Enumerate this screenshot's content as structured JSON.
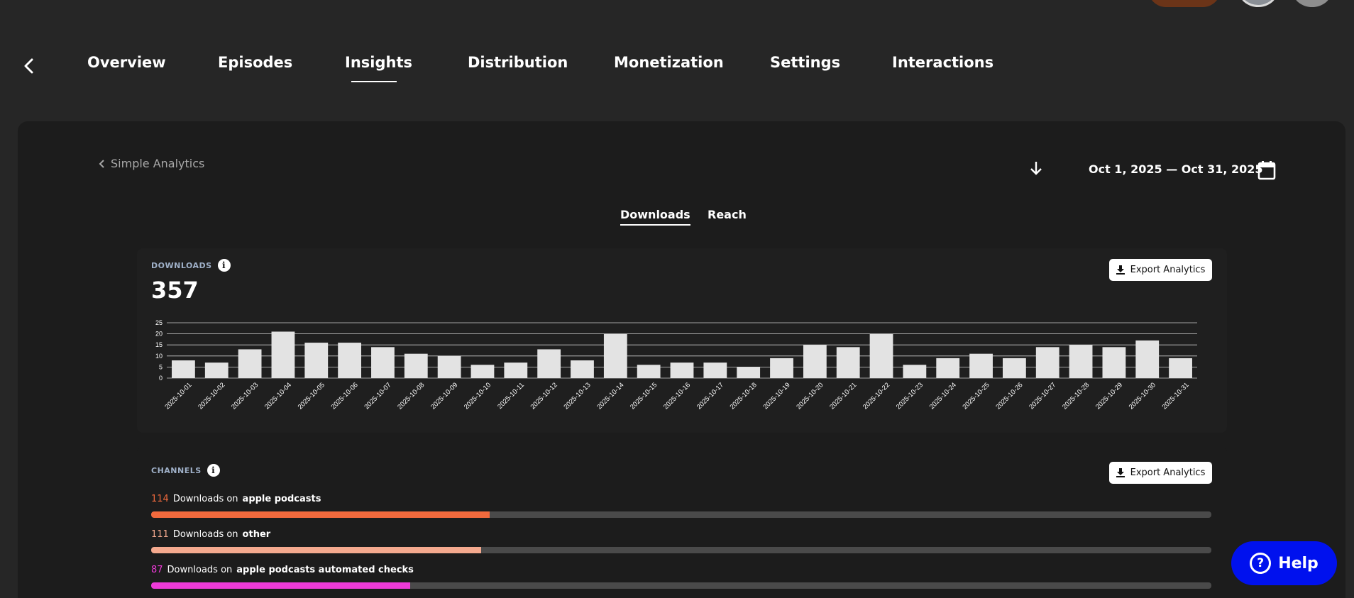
{
  "nav": {
    "tabs": [
      {
        "label": "Overview"
      },
      {
        "label": "Episodes"
      },
      {
        "label": "Insights",
        "active": true
      },
      {
        "label": "Distribution"
      },
      {
        "label": "Monetization"
      },
      {
        "label": "Settings"
      },
      {
        "label": "Interactions"
      }
    ]
  },
  "toolbar": {
    "back_label": "Simple Analytics",
    "date_range": "Oct 1, 2025 — Oct 31, 2025"
  },
  "subtabs": [
    {
      "label": "Downloads",
      "active": true
    },
    {
      "label": "Reach"
    }
  ],
  "downloads": {
    "label": "DOWNLOADS",
    "total": "357",
    "export_label": "Export Analytics"
  },
  "chart_data": {
    "type": "bar",
    "title": "",
    "xlabel": "",
    "ylabel": "",
    "ylim": [
      0,
      25
    ],
    "yticks": [
      0,
      5,
      10,
      15,
      20,
      25
    ],
    "grid": true,
    "categories": [
      "2025-10-01",
      "2025-10-02",
      "2025-10-03",
      "2025-10-04",
      "2025-10-05",
      "2025-10-06",
      "2025-10-07",
      "2025-10-08",
      "2025-10-09",
      "2025-10-10",
      "2025-10-11",
      "2025-10-12",
      "2025-10-13",
      "2025-10-14",
      "2025-10-15",
      "2025-10-16",
      "2025-10-17",
      "2025-10-18",
      "2025-10-19",
      "2025-10-20",
      "2025-10-21",
      "2025-10-22",
      "2025-10-23",
      "2025-10-24",
      "2025-10-25",
      "2025-10-26",
      "2025-10-27",
      "2025-10-28",
      "2025-10-29",
      "2025-10-30",
      "2025-10-31"
    ],
    "values": [
      8,
      7,
      13,
      21,
      16,
      16,
      14,
      11,
      10,
      6,
      7,
      13,
      8,
      20,
      6,
      7,
      7,
      5,
      9,
      15,
      14,
      20,
      6,
      9,
      11,
      9,
      14,
      15,
      14,
      17,
      9
    ],
    "bar_color": "#e3e3e3",
    "grid_color": "#cfcfcf"
  },
  "channels": {
    "label": "CHANNELS",
    "export_label": "Export Analytics",
    "downloads_on": "Downloads on",
    "items": [
      {
        "count": "114",
        "name": "apple podcasts",
        "fraction": 0.319,
        "color": "#f26a3d"
      },
      {
        "count": "111",
        "name": "other",
        "fraction": 0.311,
        "color": "#f4a98e"
      },
      {
        "count": "87",
        "name": "apple podcasts automated checks",
        "fraction": 0.244,
        "color": "#ee3ad8"
      }
    ]
  },
  "help": {
    "label": "Help"
  }
}
